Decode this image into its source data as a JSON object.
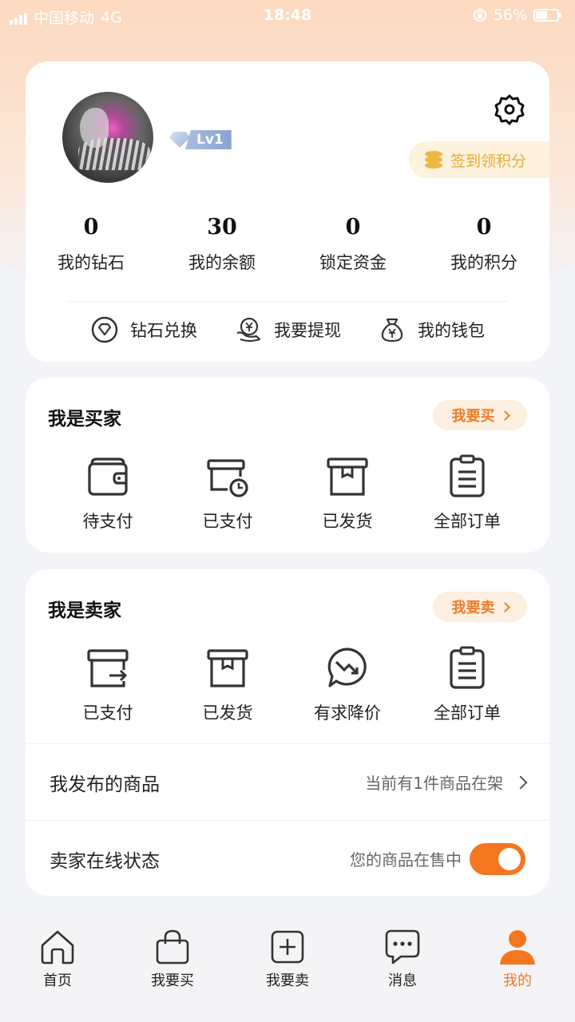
{
  "status_bar": {
    "carrier": "中国移动",
    "network": "4G",
    "time": "18:48",
    "battery": "56%"
  },
  "profile": {
    "level": "Lv1",
    "checkin_label": "签到领积分",
    "stats": [
      {
        "value": "0",
        "label": "我的钻石"
      },
      {
        "value": "30",
        "label": "我的余额"
      },
      {
        "value": "0",
        "label": "锁定资金"
      },
      {
        "value": "0",
        "label": "我的积分"
      }
    ],
    "quick_links": [
      {
        "label": "钻石兑换",
        "icon": "diamond-exchange-icon"
      },
      {
        "label": "我要提现",
        "icon": "withdraw-icon"
      },
      {
        "label": "我的钱包",
        "icon": "wallet-bag-icon"
      }
    ]
  },
  "buyer": {
    "title": "我是买家",
    "action": "我要买",
    "items": [
      {
        "label": "待支付",
        "icon": "wallet-icon"
      },
      {
        "label": "已支付",
        "icon": "paid-clock-icon"
      },
      {
        "label": "已发货",
        "icon": "box-icon"
      },
      {
        "label": "全部订单",
        "icon": "order-list-icon"
      }
    ]
  },
  "seller": {
    "title": "我是卖家",
    "action": "我要卖",
    "items": [
      {
        "label": "已支付",
        "icon": "box-arrow-icon"
      },
      {
        "label": "已发货",
        "icon": "box-icon"
      },
      {
        "label": "有求降价",
        "icon": "price-drop-chat-icon"
      },
      {
        "label": "全部订单",
        "icon": "order-list-icon"
      }
    ],
    "published_label": "我发布的商品",
    "published_value": "当前有1件商品在架",
    "online_label": "卖家在线状态",
    "online_value": "您的商品在售中",
    "online_enabled": true
  },
  "tabbar": [
    {
      "label": "首页",
      "icon": "home-icon",
      "active": false
    },
    {
      "label": "我要买",
      "icon": "shopping-bag-icon",
      "active": false
    },
    {
      "label": "我要卖",
      "icon": "add-square-icon",
      "active": false
    },
    {
      "label": "消息",
      "icon": "message-icon",
      "active": false
    },
    {
      "label": "我的",
      "icon": "person-icon",
      "active": true
    }
  ],
  "colors": {
    "accent": "#f4761f",
    "checkin": "#e9a935",
    "level_badge": "#9fb2d6"
  }
}
